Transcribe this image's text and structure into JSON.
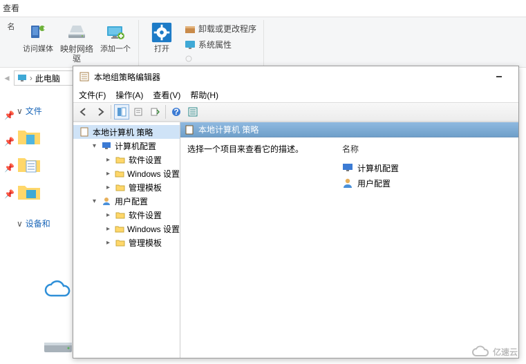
{
  "explorer": {
    "tab_view": "查看",
    "ribbon": {
      "naming": "名",
      "access_media": "访问媒体",
      "map_drive_l1": "映射网络",
      "map_drive_l2": "驱",
      "add_one": "添加一个",
      "open": "打开",
      "uninstall": "卸载或更改程序",
      "system_props": "系统属性"
    },
    "breadcrumb": "此电脑",
    "side_files": "文件",
    "side_devices": "设备和"
  },
  "gpedit": {
    "title": "本地组策略编辑器",
    "menu": {
      "file": "文件(F)",
      "action": "操作(A)",
      "view": "查看(V)",
      "help": "帮助(H)"
    },
    "tree": {
      "root": "本地计算机 策略",
      "computer": "计算机配置",
      "sw_settings": "软件设置",
      "win_settings": "Windows 设置",
      "admin_templates": "管理模板",
      "user": "用户配置"
    },
    "detail": {
      "header": "本地计算机 策略",
      "hint": "选择一个项目来查看它的描述。",
      "col_name": "名称",
      "item_computer": "计算机配置",
      "item_user": "用户配置"
    }
  },
  "watermark": "亿速云"
}
